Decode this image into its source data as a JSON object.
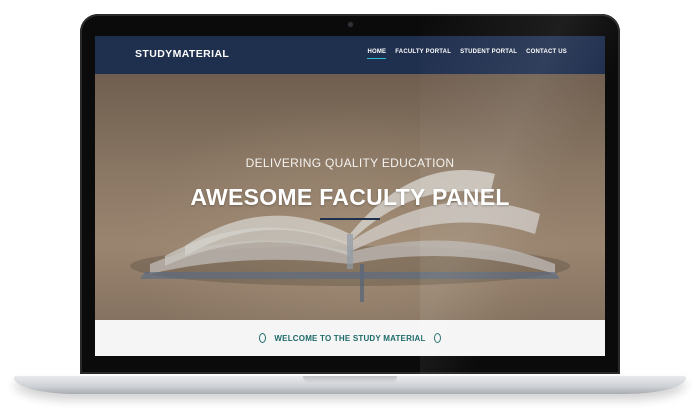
{
  "brand": {
    "name": "STUDYMATERIAL"
  },
  "nav": {
    "items": [
      {
        "label": "HOME",
        "active": true
      },
      {
        "label": "FACULTY PORTAL"
      },
      {
        "label": "STUDENT PORTAL"
      },
      {
        "label": "CONTACT US"
      }
    ]
  },
  "hero": {
    "tagline": "DELIVERING QUALITY EDUCATION",
    "title": "AWESOME FACULTY PANEL"
  },
  "welcome": {
    "text": "WELCOME TO THE STUDY MATERIAL"
  },
  "colors": {
    "navbar": "#1f2f4e",
    "accent": "#2bbbd8",
    "welcome_text": "#1f6b6a"
  },
  "icons": [
    "open-book-icon",
    "ring-icon",
    "camera-icon"
  ]
}
